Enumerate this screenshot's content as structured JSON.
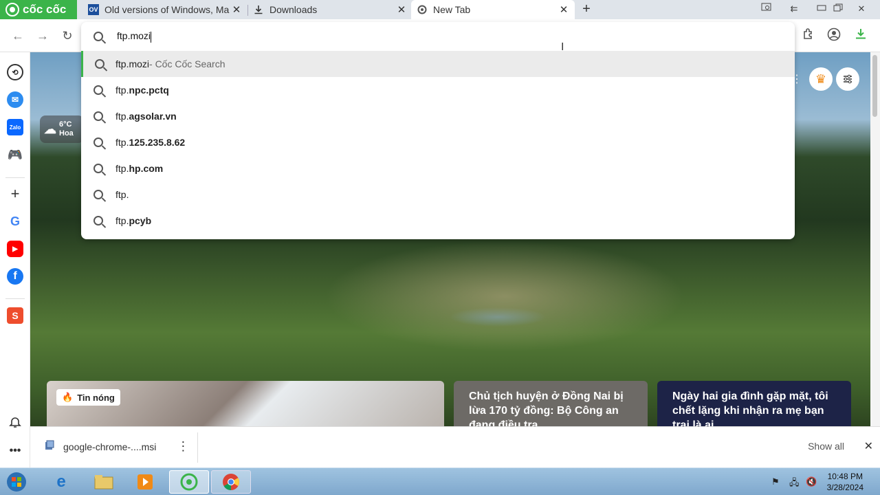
{
  "browser": {
    "brand": "cốc cốc",
    "tabs": [
      {
        "favicon": "OV",
        "title": "Old versions of Windows, Ma",
        "close": "✕"
      },
      {
        "favicon": "download-icon",
        "title": "Downloads",
        "close": "✕"
      },
      {
        "favicon": "coccoc-icon",
        "title": "New Tab",
        "close": "✕"
      }
    ],
    "new_tab": "+"
  },
  "omnibox": {
    "value": "ftp.mozi",
    "suggestions": [
      {
        "prefix": "ftp.mozi",
        "bold": "",
        "hint": " - Cốc Cốc Search"
      },
      {
        "prefix": "ftp.",
        "bold": "npc.pctq",
        "hint": ""
      },
      {
        "prefix": "ftp.",
        "bold": "agsolar.vn",
        "hint": ""
      },
      {
        "prefix": "ftp.",
        "bold": "125.235.8.62",
        "hint": ""
      },
      {
        "prefix": "ftp.",
        "bold": "hp.com",
        "hint": ""
      },
      {
        "prefix": "ftp.",
        "bold": "",
        "hint": ""
      },
      {
        "prefix": "ftp.",
        "bold": "pcyb",
        "hint": ""
      }
    ]
  },
  "weather": {
    "temp": "6°C",
    "place": "Hoa"
  },
  "news": {
    "hot_label": "Tin nóng",
    "card2": "Chủ tịch huyện ở Đồng Nai bị lừa 170 tỷ đồng: Bộ Công an đang điều tra",
    "card3": "Ngày hai gia đình gặp mặt, tôi chết lặng khi nhận ra mẹ bạn trai là ai"
  },
  "download": {
    "file": "google-chrome-....msi",
    "show_all": "Show all",
    "close": "✕"
  },
  "taskbar": {
    "time": "10:48 PM",
    "date": "3/28/2024"
  },
  "colors": {
    "brand": "#3bb44a",
    "tabstrip": "#dfe4ea",
    "taskbar": "#8fb5d8"
  }
}
